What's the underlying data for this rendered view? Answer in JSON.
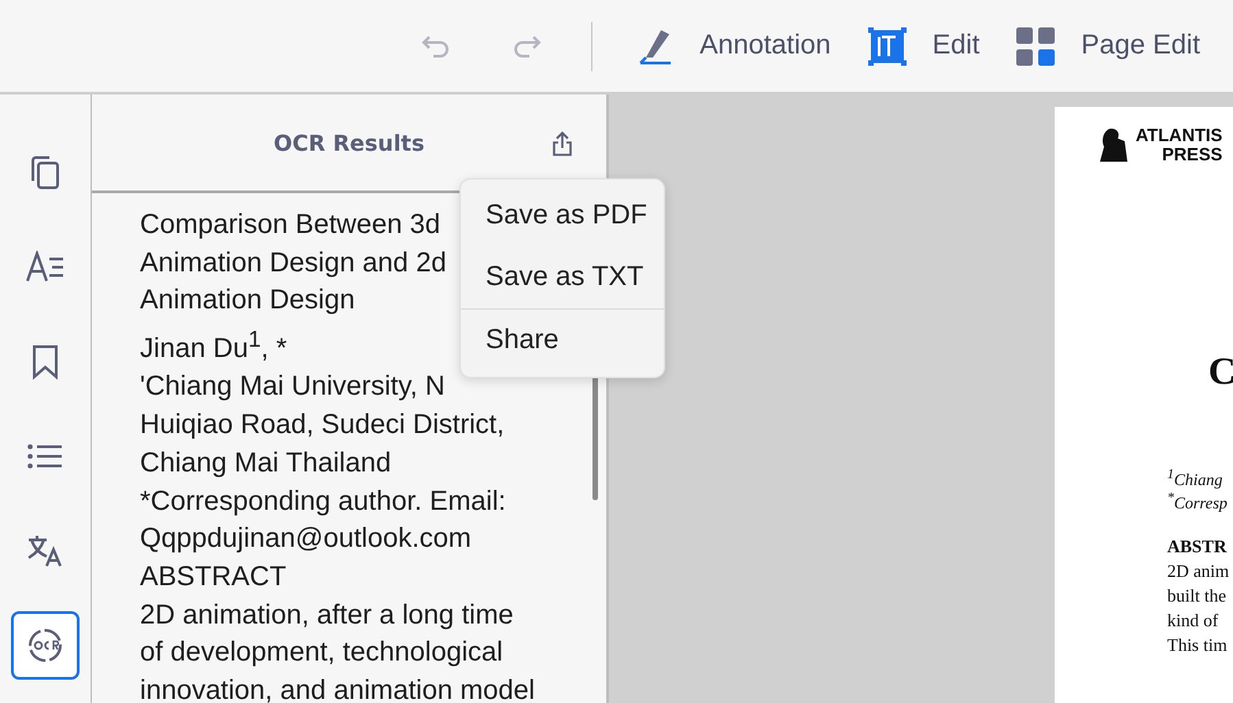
{
  "toolbar": {
    "history": [
      {
        "kind": "undo",
        "disabled": true
      },
      {
        "kind": "redo",
        "disabled": true
      }
    ],
    "tools": [
      {
        "kind": "annotation",
        "label": "Annotation"
      },
      {
        "kind": "edit",
        "label": "Edit"
      },
      {
        "kind": "page-edit",
        "label": "Page Edit"
      }
    ]
  },
  "sidebar": {
    "items": [
      {
        "kind": "pages",
        "selected": false
      },
      {
        "kind": "text",
        "selected": false
      },
      {
        "kind": "bookmark",
        "selected": false
      },
      {
        "kind": "outline",
        "selected": false
      },
      {
        "kind": "translate",
        "selected": false
      },
      {
        "kind": "ocr",
        "selected": true
      }
    ]
  },
  "ocr_panel": {
    "title": "OCR Results",
    "lines": [
      "Comparison Between 3d",
      "Animation Design and 2d",
      "Animation Design",
      "Jinan Du$^{1}$, *",
      "'Chiang Mai University, N",
      "Huiqiao Road, Sudeci District,",
      "Chiang Mai Thailand",
      "*Corresponding author. Email:",
      "Qqppdujinan@outlook.com",
      "ABSTRACT",
      "2D animation, after a long time",
      "of development, technological",
      "innovation, and animation model"
    ],
    "menu": [
      {
        "label": "Save as PDF",
        "divider_before": false
      },
      {
        "label": "Save as TXT",
        "divider_before": false
      },
      {
        "label": "Share",
        "divider_before": true
      }
    ]
  },
  "document": {
    "logo": [
      "ATLANTIS",
      "PRESS"
    ],
    "heading": "C",
    "affiliations": [
      "$^{1}$Chiang",
      "$^{*}$Corresp"
    ],
    "abstract_heading": "ABSTR",
    "abstract_lines": [
      "2D anim",
      "built the",
      "kind of",
      "This tim"
    ]
  }
}
